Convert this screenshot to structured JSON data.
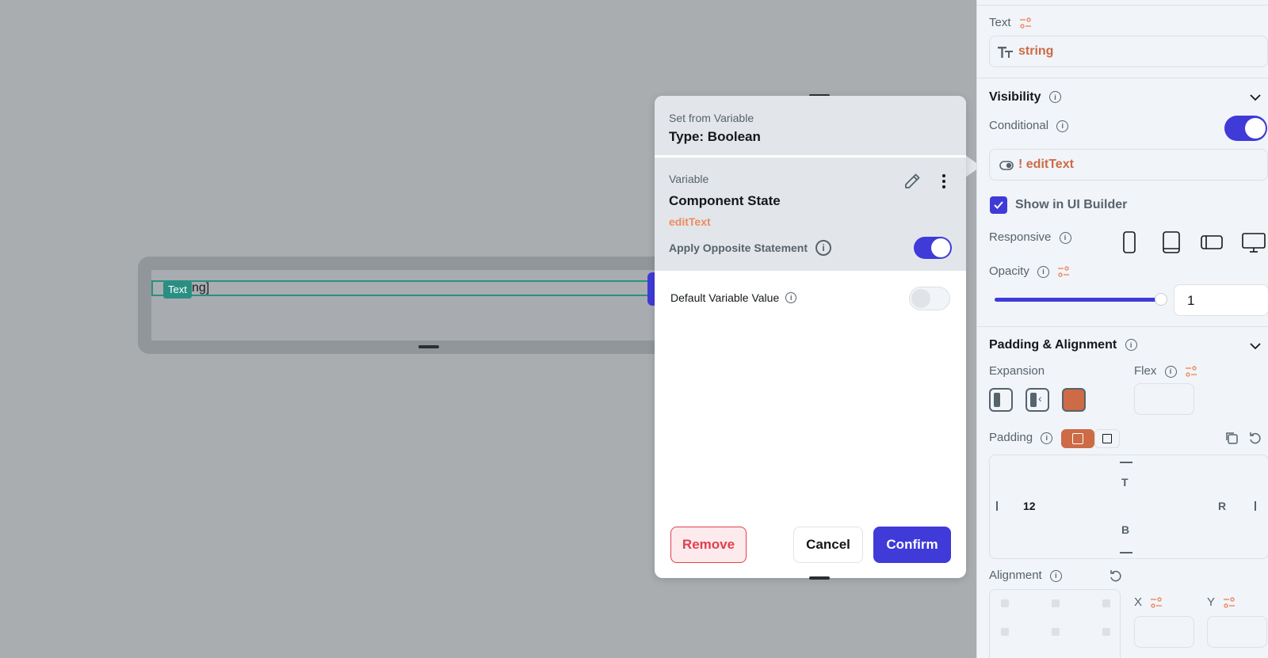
{
  "canvas": {
    "text_tag": "Text",
    "text_content": "ng]"
  },
  "modal": {
    "subtitle": "Set from Variable",
    "title": "Type: Boolean",
    "variable_label": "Variable",
    "variable_name": "Component State",
    "variable_field": "editText",
    "apply_opposite_label": "Apply Opposite Statement",
    "apply_opposite_on": true,
    "default_value_label": "Default Variable Value",
    "default_value_on": false,
    "remove_label": "Remove",
    "cancel_label": "Cancel",
    "confirm_label": "Confirm"
  },
  "panel": {
    "text_label": "Text",
    "text_value": "string",
    "visibility_label": "Visibility",
    "conditional_label": "Conditional",
    "conditional_on": true,
    "condition_value": "! editText",
    "show_in_builder_label": "Show in UI Builder",
    "show_in_builder_checked": true,
    "responsive_label": "Responsive",
    "opacity_label": "Opacity",
    "opacity_value": "1",
    "padding_alignment_label": "Padding & Alignment",
    "expansion_label": "Expansion",
    "flex_label": "Flex",
    "padding_label": "Padding",
    "padding_left": "12",
    "padding_top_letter": "T",
    "padding_right_letter": "R",
    "padding_bottom_letter": "B",
    "alignment_label": "Alignment",
    "x_label": "X",
    "y_label": "Y"
  },
  "colors": {
    "accent": "#3f3ad8",
    "orange": "#cc6b45",
    "variable_orange": "#ee8b60",
    "danger": "#e0404e",
    "teal": "#2a8f82"
  },
  "icons": [
    "text-format-icon",
    "slider-settings-icon",
    "info-icon",
    "chevron-down-icon",
    "toggle-icon",
    "phone-icon",
    "tablet-icon",
    "tablet-landscape-icon",
    "desktop-icon",
    "edit-icon",
    "more-vertical-icon",
    "copy-icon",
    "reset-icon",
    "check-icon"
  ]
}
